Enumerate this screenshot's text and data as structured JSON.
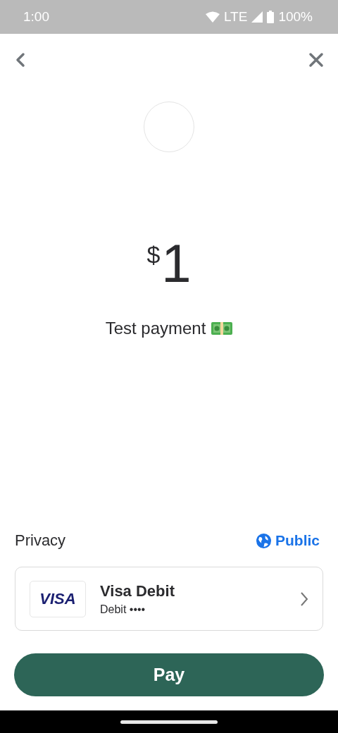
{
  "status_bar": {
    "time": "1:00",
    "network": "LTE",
    "battery": "100%"
  },
  "amount": {
    "currency": "$",
    "value": "1"
  },
  "description": "Test payment",
  "privacy": {
    "label": "Privacy",
    "value": "Public"
  },
  "payment_method": {
    "brand": "VISA",
    "name": "Visa Debit",
    "detail": "Debit ••••"
  },
  "pay_button": "Pay"
}
